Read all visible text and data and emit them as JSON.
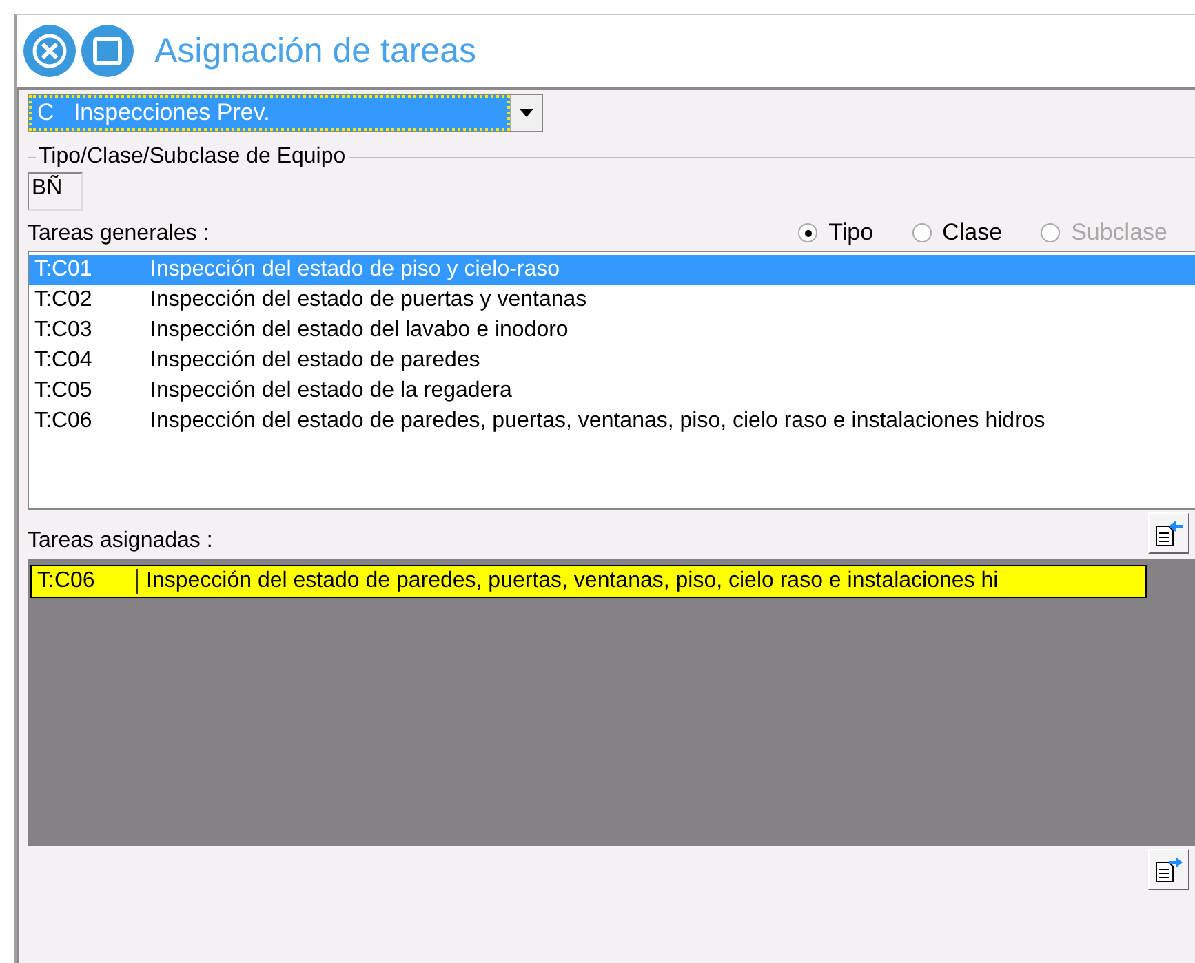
{
  "window": {
    "title": "Asignación de tareas"
  },
  "combo": {
    "value": "C   Inspecciones Prev.",
    "focused": true
  },
  "equipment_group": {
    "legend": "Tipo/Clase/Subclase de Equipo",
    "value": "BÑ"
  },
  "general_tasks": {
    "label": "Tareas generales :",
    "radios": [
      {
        "label": "Tipo",
        "selected": true,
        "disabled": false
      },
      {
        "label": "Clase",
        "selected": false,
        "disabled": false
      },
      {
        "label": "Subclase",
        "selected": false,
        "disabled": true
      }
    ],
    "rows": [
      {
        "code": "T:C01",
        "description": "Inspección del estado de piso y cielo-raso",
        "selected": true
      },
      {
        "code": "T:C02",
        "description": "Inspección del estado de puertas y ventanas",
        "selected": false
      },
      {
        "code": "T:C03",
        "description": "Inspección del estado del lavabo e inodoro",
        "selected": false
      },
      {
        "code": "T:C04",
        "description": "Inspección del estado de paredes",
        "selected": false
      },
      {
        "code": "T:C05",
        "description": "Inspección del estado de la regadera",
        "selected": false
      },
      {
        "code": "T:C06",
        "description": "Inspección del estado de paredes, puertas, ventanas, piso, cielo raso e instalaciones hidros",
        "selected": false
      }
    ]
  },
  "assigned_tasks": {
    "label": "Tareas asignadas :",
    "rows": [
      {
        "code": "T:C06",
        "description": "Inspección del estado de paredes, puertas, ventanas, piso, cielo raso e instalaciones hi",
        "selected": true
      }
    ]
  }
}
